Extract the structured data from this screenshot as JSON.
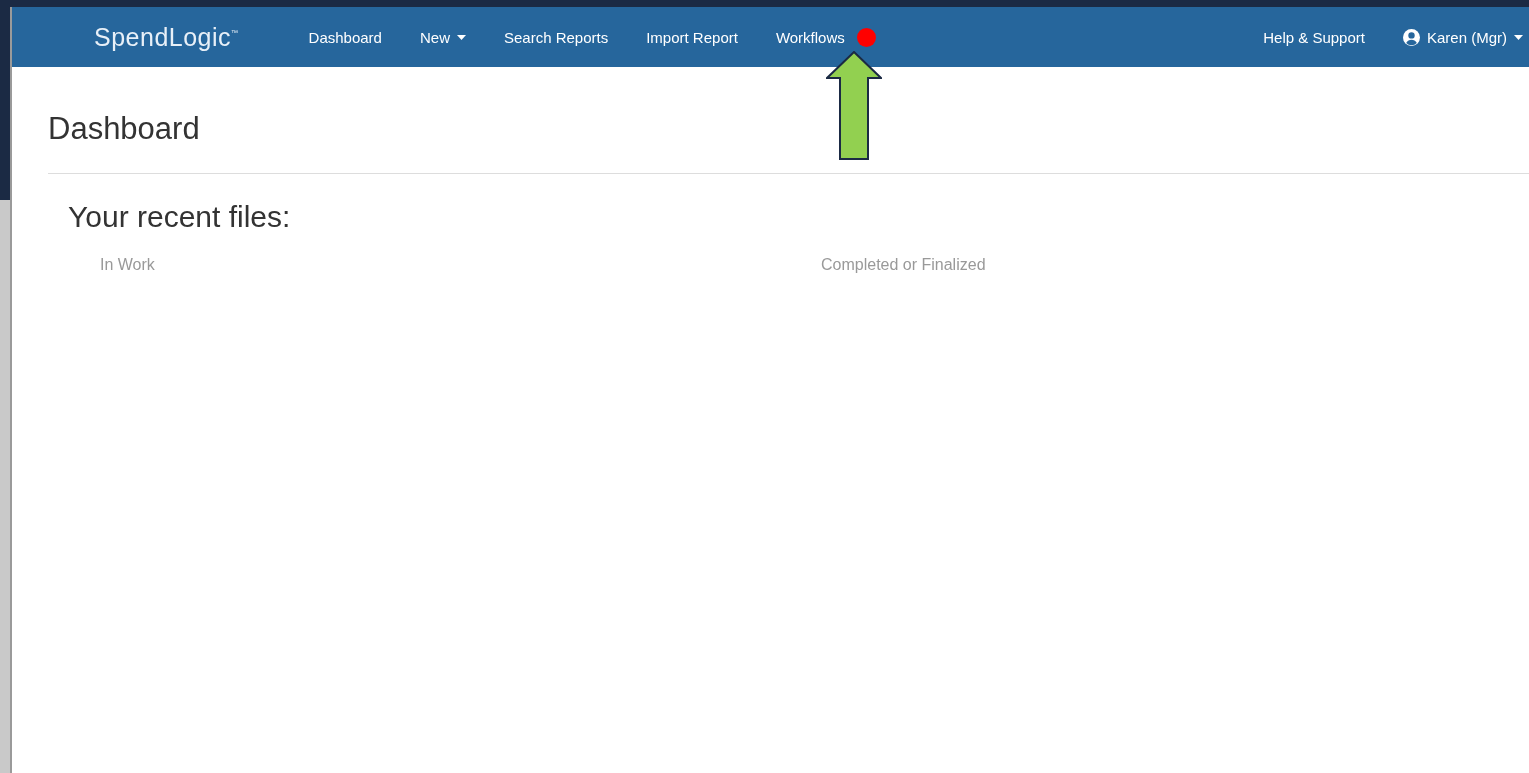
{
  "navbar": {
    "logo": {
      "name": "SpendLogic",
      "mark": "™"
    },
    "items": [
      {
        "label": "Dashboard",
        "kind": "link",
        "notice": false
      },
      {
        "label": "New",
        "kind": "dropdown",
        "notice": false
      },
      {
        "label": "Search Reports",
        "kind": "link",
        "notice": false
      },
      {
        "label": "Import Report",
        "kind": "link",
        "notice": false
      },
      {
        "label": "Workflows",
        "kind": "link",
        "notice": true
      }
    ],
    "right_items": [
      {
        "label": "Help & Support",
        "kind": "link"
      },
      {
        "label": "Karen (Mgr)",
        "kind": "user"
      }
    ]
  },
  "page": {
    "title": "Dashboard",
    "section_title": "Your recent files:",
    "columns": [
      "In Work",
      "Completed or Finalized"
    ]
  }
}
